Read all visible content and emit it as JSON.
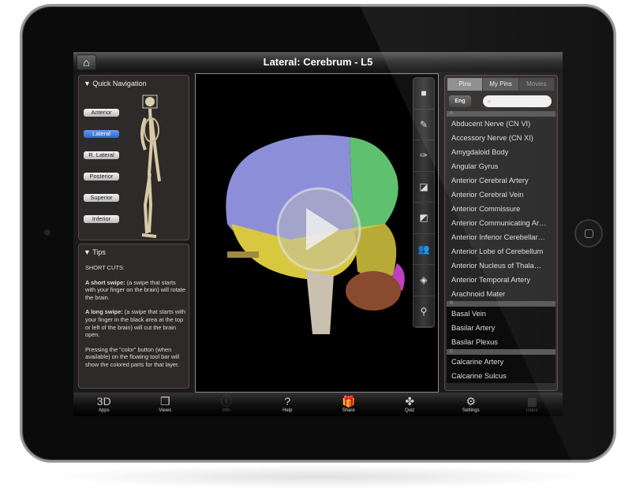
{
  "header": {
    "title": "Lateral: Cerebrum - L5",
    "home_icon": "home-icon"
  },
  "quick_nav": {
    "title": "Quick Navigation",
    "buttons": [
      "Anterior",
      "Lateral",
      "R. Lateral",
      "Posterior",
      "Superior",
      "Inferior"
    ],
    "selected": "Lateral"
  },
  "tips": {
    "title": "Tips",
    "heading": "SHORT CUTS:",
    "p1_bold": "A short swipe:",
    "p1": " (a swipe that starts with your finger on the brain) will rotate the brain.",
    "p2_bold": "A long swipe:",
    "p2": " (a swipe that starts with your finger in the black area at the top or left of the brain) will cut the brain open.",
    "p3": "Pressing the \"color\" button (when available) on the floating tool bar will show the colored parts for that layer."
  },
  "viewer": {
    "tools": [
      "color-square-icon",
      "scalpel-add-icon",
      "scalpel-remove-icon",
      "cut-plane-icon",
      "cut-plane-reverse-icon",
      "people-icon",
      "orientation-icon",
      "pin-icon"
    ],
    "play_icon": "play-icon"
  },
  "pins_panel": {
    "tabs": [
      "Pins",
      "My Pins",
      "Movies"
    ],
    "active_tab": "Pins",
    "lang_button": "Eng",
    "search_placeholder": "",
    "sections": [
      {
        "letter": "A",
        "items": [
          "Abducent Nerve (CN VI)",
          "Accessory Nerve (CN XI)",
          "Amygdaloid Body",
          "Angular Gyrus",
          "Anterior Cerebral Artery",
          "Anterior Cerebral Vein",
          "Anterior Commissure",
          "Anterior Communicating Ar…",
          "Anterior Inferior Cerebellar…",
          "Anterior Lobe of Cerebellum",
          "Anterior Nucleus of Thala…",
          "Anterior Temporal Artery",
          "Arachnoid Mater"
        ]
      },
      {
        "letter": "B",
        "items": [
          "Basal Vein",
          "Basilar Artery",
          "Basilar Plexus"
        ]
      },
      {
        "letter": "C",
        "items": [
          "Calcarine Artery",
          "Calcarine Sulcus"
        ]
      }
    ]
  },
  "tabbar": [
    {
      "label": "Apps",
      "icon": "3D",
      "enabled": true
    },
    {
      "label": "Views",
      "icon": "❐",
      "enabled": true
    },
    {
      "label": "Info",
      "icon": "ⓘ",
      "enabled": false
    },
    {
      "label": "Help",
      "icon": "?",
      "enabled": true
    },
    {
      "label": "Share",
      "icon": "🎁",
      "enabled": true
    },
    {
      "label": "Quiz",
      "icon": "✤",
      "enabled": true
    },
    {
      "label": "Settings",
      "icon": "⚙",
      "enabled": true
    },
    {
      "label": "Index",
      "icon": "▦",
      "enabled": false
    }
  ],
  "colors": {
    "selected_button": "#2e64d0",
    "brain_purple": "#8c8ed8",
    "brain_green": "#5fc070",
    "brain_yellow": "#d8c840"
  }
}
